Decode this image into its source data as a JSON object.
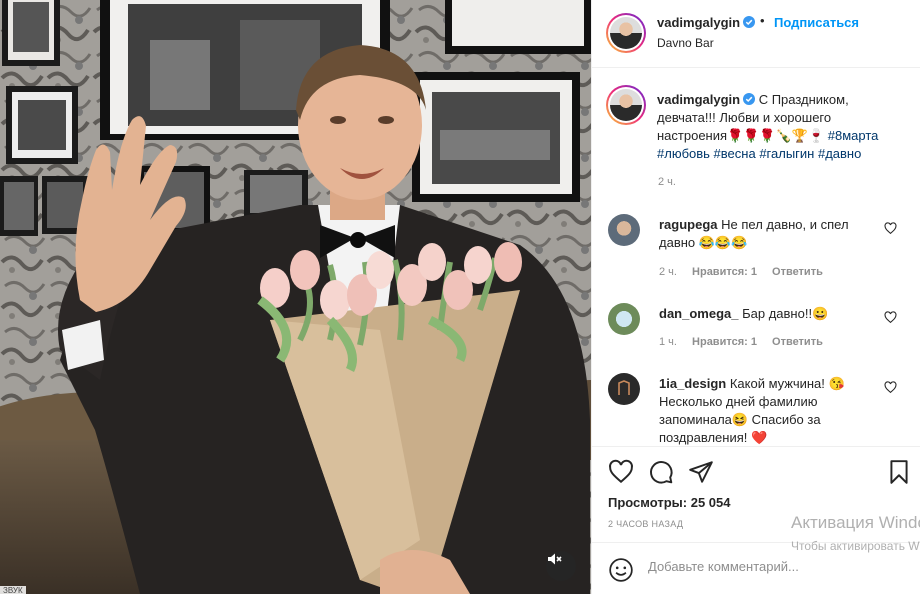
{
  "post": {
    "username": "vadimgalygin",
    "follow_label": "Подписаться",
    "dot": "•",
    "location": "Davno Bar",
    "caption_username": "vadimgalygin",
    "caption_text": "С Праздником, девчата!!! Любви и хорошего настроения🌹🌹🌹🍾🏆🍷",
    "hashtags": [
      "#8марта",
      "#любовь",
      "#весна",
      "#галыгин",
      "#давно"
    ],
    "caption_time": "2 ч."
  },
  "comments": [
    {
      "username": "ragupega",
      "text": "Не пел давно, и спел давно 😂😂😂",
      "time": "2 ч.",
      "likes": "Нравится: 1",
      "reply": "Ответить"
    },
    {
      "username": "dan_omega_",
      "text": "Бар давно!!😀",
      "time": "1 ч.",
      "likes": "Нравится: 1",
      "reply": "Ответить"
    },
    {
      "username": "1ia_design",
      "text": "Какой мужчина! 😘 Несколько дней фамилию запоминала😆 Спасибо за поздравления! ❤️"
    }
  ],
  "stats": {
    "views_label": "Просмотры:",
    "views_value": "25 054",
    "posted_ago": "2 ЧАСОВ НАЗАД"
  },
  "add_comment": {
    "placeholder": "Добавьте комментарий..."
  },
  "media": {
    "caption": "ЗВУК"
  },
  "watermark": {
    "title": "Активация Windows",
    "subtitle": "Чтобы активировать Windows, перейдите в раздел \"Параметры\"."
  },
  "icons": {
    "verified": "verified-badge-icon",
    "like": "heart-icon",
    "comment": "comment-icon",
    "share": "paper-plane-icon",
    "save": "bookmark-icon",
    "mute": "speaker-muted-icon",
    "emoji": "smiley-icon"
  },
  "colors": {
    "accent": "#0095f6",
    "hashtag": "#00376b",
    "text": "#262626",
    "muted": "#8e8e8e",
    "border": "#efefef"
  }
}
